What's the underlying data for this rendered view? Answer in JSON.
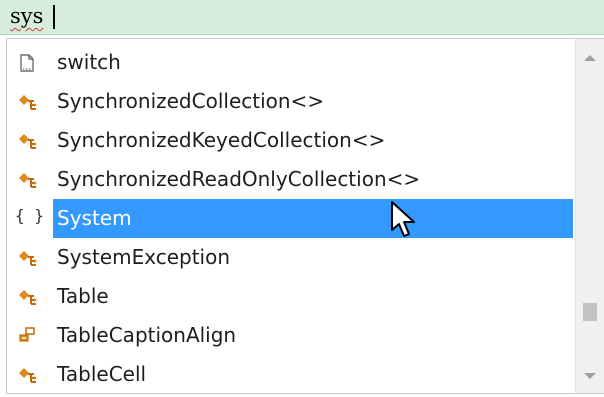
{
  "editor": {
    "typed_text": "sys"
  },
  "completion_list": {
    "items": [
      {
        "label": "switch",
        "icon": "snippet-icon"
      },
      {
        "label": "SynchronizedCollection<>",
        "icon": "class-icon"
      },
      {
        "label": "SynchronizedKeyedCollection<>",
        "icon": "class-icon"
      },
      {
        "label": "SynchronizedReadOnlyCollection<>",
        "icon": "class-icon"
      },
      {
        "label": "System",
        "icon": "namespace-icon",
        "selected": true
      },
      {
        "label": "SystemException",
        "icon": "class-icon"
      },
      {
        "label": "Table",
        "icon": "class-icon"
      },
      {
        "label": "TableCaptionAlign",
        "icon": "enum-icon"
      },
      {
        "label": "TableCell",
        "icon": "class-icon"
      }
    ],
    "namespace_glyph": "{ }"
  },
  "colors": {
    "editor_line": "#d6eddb",
    "selection": "#3399ff",
    "class_icon": "#e08a1e"
  }
}
